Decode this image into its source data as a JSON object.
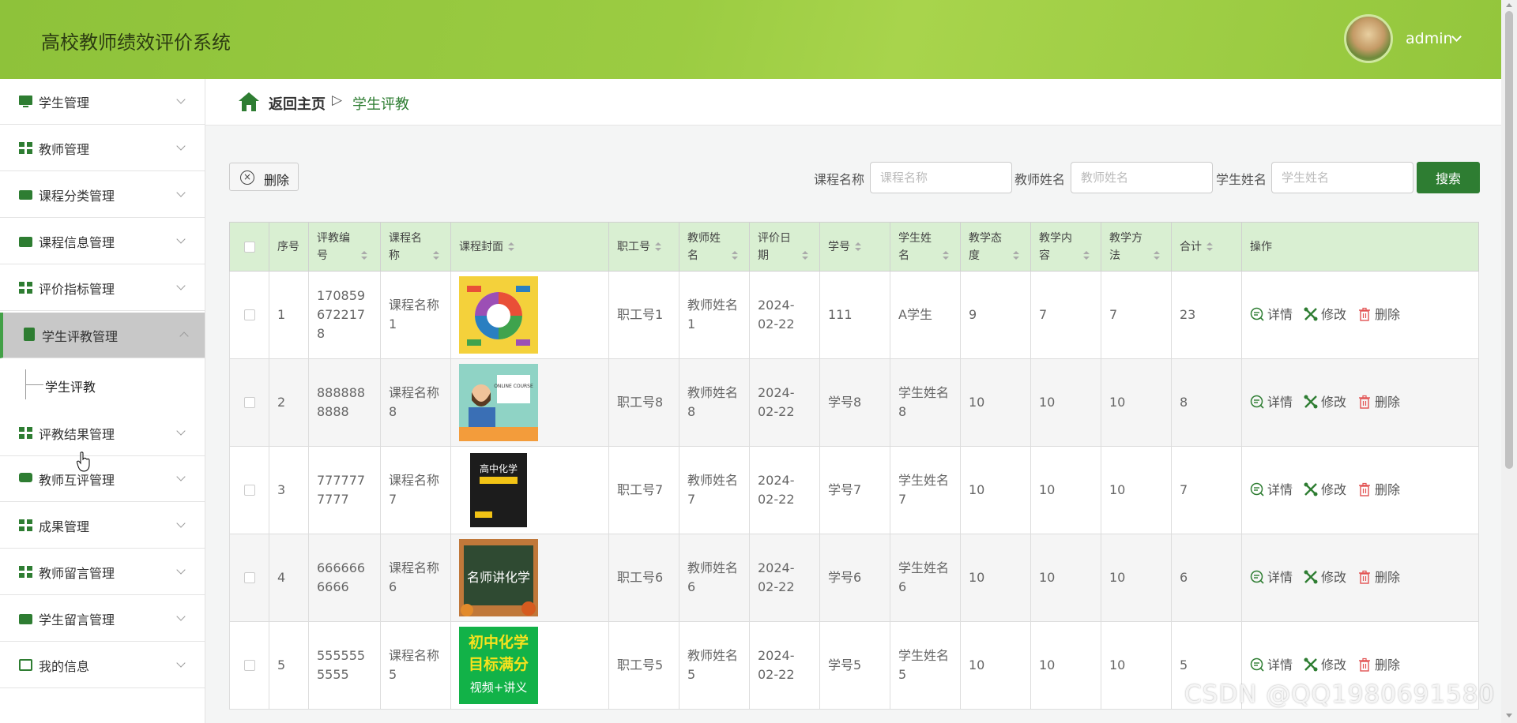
{
  "app": {
    "title": "高校教师绩效评价系统",
    "user": "admin"
  },
  "sidebar": {
    "items": [
      {
        "label": "学生管理",
        "icon": "monitor-icon"
      },
      {
        "label": "教师管理",
        "icon": "grid-icon"
      },
      {
        "label": "课程分类管理",
        "icon": "ticket-icon"
      },
      {
        "label": "课程信息管理",
        "icon": "wallet-icon"
      },
      {
        "label": "评价指标管理",
        "icon": "grid-icon"
      },
      {
        "label": "学生评教管理",
        "icon": "clipboard-icon",
        "expanded": true
      },
      {
        "label": "评教结果管理",
        "icon": "grid-icon"
      },
      {
        "label": "教师互评管理",
        "icon": "chat-icon"
      },
      {
        "label": "成果管理",
        "icon": "grid-icon"
      },
      {
        "label": "教师留言管理",
        "icon": "grid-icon"
      },
      {
        "label": "学生留言管理",
        "icon": "briefcase-icon"
      },
      {
        "label": "我的信息",
        "icon": "card-icon"
      }
    ],
    "sub_item": "学生评教"
  },
  "breadcrumb": {
    "home": "返回主页",
    "separator": "▷",
    "current": "学生评教"
  },
  "toolbar": {
    "delete_label": "删除",
    "search": [
      {
        "label": "课程名称",
        "placeholder": "课程名称"
      },
      {
        "label": "教师姓名",
        "placeholder": "教师姓名"
      },
      {
        "label": "学生姓名",
        "placeholder": "学生姓名"
      }
    ],
    "search_button": "搜索"
  },
  "table": {
    "headers": [
      "序号",
      "评教编号",
      "课程名称",
      "课程封面",
      "职工号",
      "教师姓名",
      "评价日期",
      "学号",
      "学生姓名",
      "教学态度",
      "教学内容",
      "教学方法",
      "合计",
      "操作"
    ],
    "actions": [
      "详情",
      "修改",
      "删除"
    ],
    "rows": [
      {
        "index": "1",
        "code": "1708596722178",
        "course": "课程名称1",
        "cover": "colorful-infographic",
        "staff": "职工号1",
        "teacher": "教师姓名1",
        "date": "2024-02-22",
        "student_no": "111",
        "student": "A学生",
        "attitude": "9",
        "content": "7",
        "method": "7",
        "total": "23"
      },
      {
        "index": "2",
        "code": "8888888888",
        "course": "课程名称8",
        "cover": "online-course",
        "staff": "职工号8",
        "teacher": "教师姓名8",
        "date": "2024-02-22",
        "student_no": "学号8",
        "student": "学生姓名8",
        "attitude": "10",
        "content": "10",
        "method": "10",
        "total": "8"
      },
      {
        "index": "3",
        "code": "7777777777",
        "course": "课程名称7",
        "cover": "chemistry-book",
        "staff": "职工号7",
        "teacher": "教师姓名7",
        "date": "2024-02-22",
        "student_no": "学号7",
        "student": "学生姓名7",
        "attitude": "10",
        "content": "10",
        "method": "10",
        "total": "7"
      },
      {
        "index": "4",
        "code": "6666666666",
        "course": "课程名称6",
        "cover": "chalkboard",
        "staff": "职工号6",
        "teacher": "教师姓名6",
        "date": "2024-02-22",
        "student_no": "学号6",
        "student": "学生姓名6",
        "attitude": "10",
        "content": "10",
        "method": "10",
        "total": "6"
      },
      {
        "index": "5",
        "code": "5555555555",
        "course": "课程名称5",
        "cover": "chemistry-green",
        "staff": "职工号5",
        "teacher": "教师姓名5",
        "date": "2024-02-22",
        "student_no": "学号5",
        "student": "学生姓名5",
        "attitude": "10",
        "content": "10",
        "method": "10",
        "total": "5"
      }
    ]
  },
  "covers": {
    "chemistry_book_text": "高中化学",
    "chalkboard_text": "名师讲化学",
    "green_line1": "初中化学",
    "green_line2": "目标满分",
    "green_line3": "视频+讲义",
    "online_text": "ONLINE COURSE"
  },
  "watermark": "CSDN @QQ1980691580",
  "colors": {
    "accent": "#2e7d32",
    "header": "#9bcc42",
    "table_header": "#d9efd2"
  }
}
